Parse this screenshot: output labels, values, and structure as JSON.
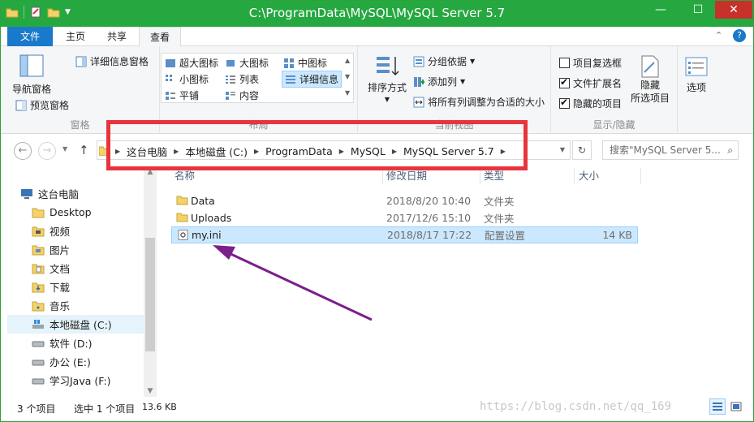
{
  "window": {
    "title": "C:\\ProgramData\\MySQL\\MySQL Server 5.7",
    "controls": {
      "minimize": "—",
      "maximize": "☐",
      "close": "✕"
    }
  },
  "tabs": [
    {
      "label": "文件"
    },
    {
      "label": "主页"
    },
    {
      "label": "共享"
    },
    {
      "label": "查看"
    }
  ],
  "ribbon": {
    "panes": {
      "name": "窗格",
      "nav_pane": "导航窗格",
      "details_pane": "详细信息窗格",
      "preview_pane": "预览窗格"
    },
    "layout": {
      "name": "布局",
      "items": [
        "超大图标",
        "大图标",
        "中图标",
        "小图标",
        "列表",
        "详细信息",
        "平铺",
        "内容"
      ]
    },
    "current_view": {
      "name": "当前视图",
      "sort": "排序方式",
      "group_by": "分组依据",
      "add_column": "添加列",
      "fit_columns": "将所有列调整为合适的大小"
    },
    "show_hide": {
      "name": "显示/隐藏",
      "item_checkboxes": {
        "label": "项目复选框",
        "checked": false
      },
      "file_extensions": {
        "label": "文件扩展名",
        "checked": true
      },
      "hidden_items": {
        "label": "隐藏的项目",
        "checked": true
      },
      "hide_selected": "隐藏\n所选项目"
    },
    "options": "选项"
  },
  "address": {
    "breadcrumbs": [
      "这台电脑",
      "本地磁盘 (C:)",
      "ProgramData",
      "MySQL",
      "MySQL Server 5.7"
    ],
    "search_placeholder": "搜索\"MySQL Server 5...",
    "up": "↑",
    "back": "←",
    "forward": "→",
    "refresh": "↻"
  },
  "nav_tree": [
    {
      "label": "这台电脑",
      "icon": "computer-icon"
    },
    {
      "label": "Desktop",
      "icon": "folder-icon"
    },
    {
      "label": "视频",
      "icon": "video-folder-icon"
    },
    {
      "label": "图片",
      "icon": "pictures-folder-icon"
    },
    {
      "label": "文档",
      "icon": "documents-folder-icon"
    },
    {
      "label": "下载",
      "icon": "downloads-folder-icon"
    },
    {
      "label": "音乐",
      "icon": "music-folder-icon"
    },
    {
      "label": "本地磁盘 (C:)",
      "icon": "windows-drive-icon"
    },
    {
      "label": "软件 (D:)",
      "icon": "drive-icon"
    },
    {
      "label": "办公 (E:)",
      "icon": "drive-icon"
    },
    {
      "label": "学习Java (F:)",
      "icon": "drive-icon"
    }
  ],
  "columns": {
    "name": "名称",
    "date": "修改日期",
    "type": "类型",
    "size": "大小"
  },
  "files": [
    {
      "name": "Data",
      "date": "2018/8/20 10:40",
      "type": "文件夹",
      "size": ""
    },
    {
      "name": "Uploads",
      "date": "2017/12/6 15:10",
      "type": "文件夹",
      "size": ""
    },
    {
      "name": "my.ini",
      "date": "2018/8/17 17:22",
      "type": "配置设置",
      "size": "14 KB"
    }
  ],
  "status": {
    "item_count": "3 个项目",
    "selected": "选中 1 个项目",
    "selected_size": "13.6 KB"
  },
  "watermark": "https://blog.csdn.net/qq_169",
  "colors": {
    "titlebar": "#26a841",
    "file_tab": "#1979ca",
    "highlight_box": "#e8343c",
    "arrow": "#7b1f8a",
    "selection": "#cce8ff"
  }
}
